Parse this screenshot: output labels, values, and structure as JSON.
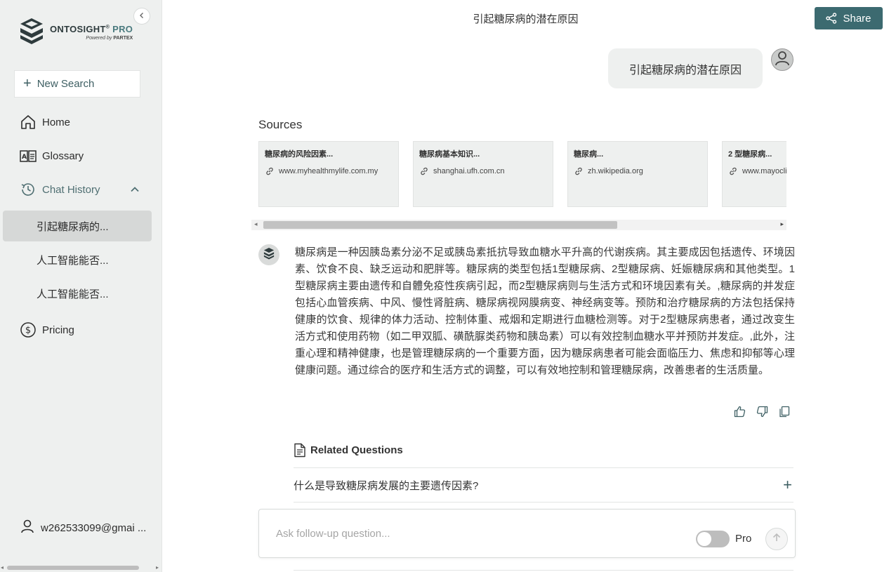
{
  "app": {
    "brand_main": "ONTOSIGHT",
    "brand_reg": "®",
    "brand_pro": " PRO",
    "brand_sub_prefix": "Powered by",
    "brand_sub_company": "PARTEX"
  },
  "sidebar": {
    "new_search_label": "New Search",
    "nav": {
      "home": "Home",
      "glossary": "Glossary",
      "chat_history": "Chat History",
      "pricing": "Pricing"
    },
    "history": [
      {
        "label": "引起糖尿病的...",
        "active": true
      },
      {
        "label": "人工智能能否...",
        "active": false
      },
      {
        "label": "人工智能能否...",
        "active": false
      }
    ],
    "user_email": "w262533099@gmai ..."
  },
  "header": {
    "title": "引起糖尿病的潜在原因",
    "share_label": "Share"
  },
  "conversation": {
    "user_message": "引起糖尿病的潜在原因",
    "sources_title": "Sources",
    "sources": [
      {
        "title": "糖尿病的风险因素...",
        "url": "www.myhealthmylife.com.my"
      },
      {
        "title": "糖尿病基本知识...",
        "url": "shanghai.ufh.com.cn"
      },
      {
        "title": "糖尿病...",
        "url": "zh.wikipedia.org"
      },
      {
        "title": "2 型糖尿病...",
        "url": "www.mayoclinic.org"
      }
    ],
    "answer": "糖尿病是一种因胰岛素分泌不足或胰岛素抵抗导致血糖水平升高的代谢疾病。其主要成因包括遗传、环境因素、饮食不良、缺乏运动和肥胖等。糖尿病的类型包括1型糖尿病、2型糖尿病、妊娠糖尿病和其他类型。1型糖尿病主要由遗传和自體免疫性疾病引起，而2型糖尿病则与生活方式和环境因素有关。,糖尿病的并发症包括心血管疾病、中风、慢性肾脏病、糖尿病视网膜病变、神经病变等。预防和治疗糖尿病的方法包括保持健康的饮食、规律的体力活动、控制体重、戒烟和定期进行血糖检测等。对于2型糖尿病患者，通过改变生活方式和使用药物（如二甲双胍、磺酰脲类药物和胰岛素）可以有效控制血糖水平并预防并发症。,此外，注重心理和精神健康，也是管理糖尿病的一个重要方面，因为糖尿病患者可能会面临压力、焦虑和抑郁等心理健康问题。通过综合的医疗和生活方式的调整，可以有效地控制和管理糖尿病，改善患者的生活质量。",
    "related_title": "Related Questions",
    "related_questions": [
      "什么是导致糖尿病发展的主要遗传因素?"
    ]
  },
  "composer": {
    "placeholder": "Ask follow-up question...",
    "pro_label": "Pro",
    "pro_enabled": false
  },
  "colors": {
    "accent": "#3c6a70",
    "sidebar_bg": "#eef0ef",
    "active_item": "#d6d8d7"
  }
}
